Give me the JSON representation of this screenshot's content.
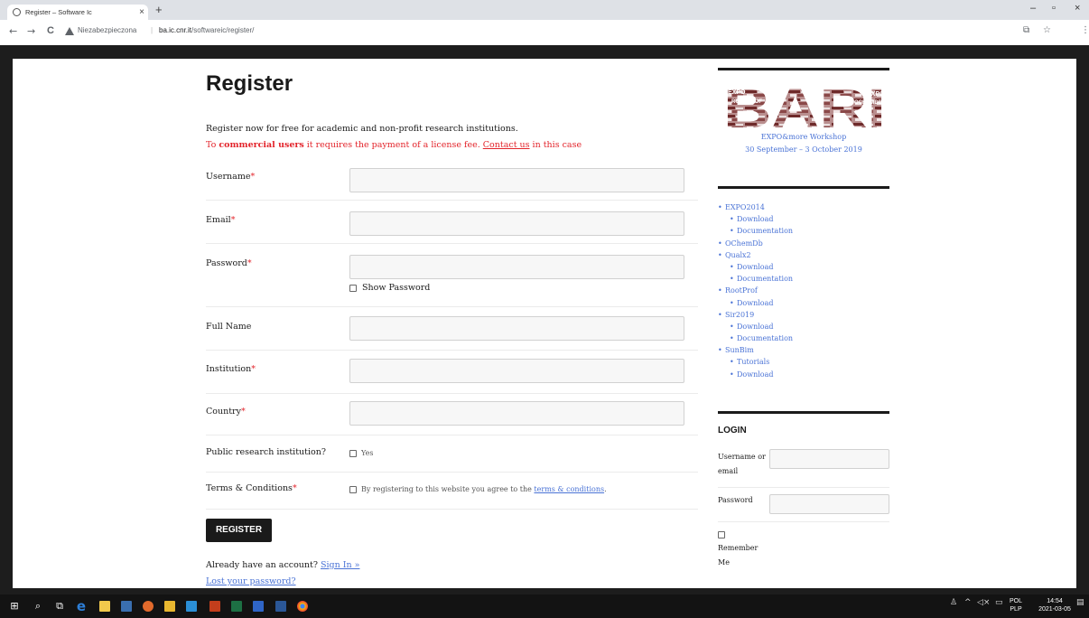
{
  "browser": {
    "tab_title": "Register – Software Ic",
    "tab_close": "×",
    "new_tab": "+",
    "nav": {
      "back": "←",
      "forward": "→",
      "reload": "C"
    },
    "security_text": "Niezabezpieczona",
    "url_domain": "ba.ic.cnr.it",
    "url_path": "/softwareic/register/",
    "window_controls": {
      "minimize": "–",
      "maximize": "▫",
      "close": "×"
    }
  },
  "page": {
    "title": "Register",
    "intro_line1": "Register now for free for academic and non-profit research institutions.",
    "intro_prefix": "To ",
    "intro_bold": "commercial users",
    "intro_middle": " it requires the payment of a license fee. ",
    "intro_link": "Contact us",
    "intro_suffix": " in this case",
    "fields": {
      "username": "Username",
      "email": "Email",
      "password": "Password",
      "full_name": "Full Name",
      "institution": "Institution",
      "country": "Country",
      "public_research": "Public research institution?",
      "terms": "Terms & Conditions"
    },
    "required_mark": "*",
    "show_password": "Show Password",
    "yes_label": "Yes",
    "terms_text": "By registering to this website you agree to the ",
    "terms_link": "terms & conditions",
    "terms_end": ".",
    "register_button": "REGISTER",
    "already_text": "Already have an account? ",
    "sign_in_link": "Sign In »",
    "lost_password": "Lost your password?"
  },
  "sidebar": {
    "workshop_name": "EXPO&more Workshop",
    "workshop_dates": "30 September – 3 October 2019",
    "logo_text": "BARI",
    "logo_tags": [
      "EXPO",
      "ROOTPROF",
      "OCHEMDB",
      "EXPO",
      "EXPO"
    ],
    "links": [
      {
        "label": "EXPO2014",
        "level": 1
      },
      {
        "label": "Download",
        "level": 2
      },
      {
        "label": "Documentation",
        "level": 2
      },
      {
        "label": "OChemDb",
        "level": 1
      },
      {
        "label": "Qualx2",
        "level": 1
      },
      {
        "label": "Download",
        "level": 2
      },
      {
        "label": "Documentation",
        "level": 2
      },
      {
        "label": "RootProf",
        "level": 1
      },
      {
        "label": "Download",
        "level": 2
      },
      {
        "label": "Sir2019",
        "level": 1
      },
      {
        "label": "Download",
        "level": 2
      },
      {
        "label": "Documentation",
        "level": 2
      },
      {
        "label": "SunBim",
        "level": 1
      },
      {
        "label": "Tutorials",
        "level": 2
      },
      {
        "label": "Download",
        "level": 2
      }
    ],
    "login_title": "LOGIN",
    "login_username_1": "Username or",
    "login_username_2": "email",
    "login_password": "Password",
    "remember_1": "Remember",
    "remember_2": "Me"
  },
  "taskbar": {
    "lang_1": "POL",
    "lang_2": "PLP",
    "time": "14:54",
    "date": "2021-03-05"
  },
  "colors": {
    "accent_red": "#e3242b",
    "link_blue": "#4a73d6",
    "button_dark": "#1a1a1a"
  }
}
